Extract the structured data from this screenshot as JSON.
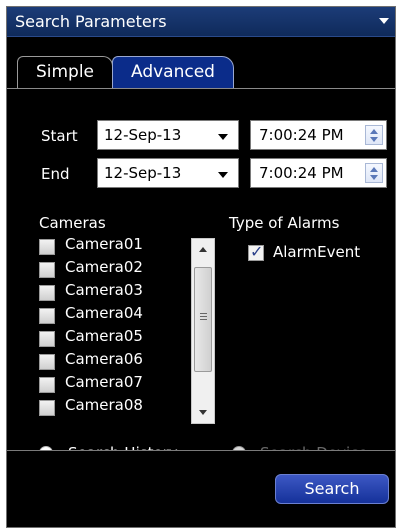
{
  "panel": {
    "title": "Search Parameters"
  },
  "tabs": {
    "simple": "Simple",
    "advanced": "Advanced"
  },
  "range": {
    "start_label": "Start",
    "end_label": "End",
    "start_date": "12-Sep-13",
    "end_date": "12-Sep-13",
    "start_time": "7:00:24 PM",
    "end_time": "7:00:24 PM"
  },
  "cameras": {
    "heading": "Cameras",
    "items": [
      "Camera01",
      "Camera02",
      "Camera03",
      "Camera04",
      "Camera05",
      "Camera06",
      "Camera07",
      "Camera08"
    ]
  },
  "alarms": {
    "heading": "Type of Alarms",
    "item": "AlarmEvent",
    "checked": true
  },
  "mode": {
    "history_label": "Search History",
    "device_label": "Search Device"
  },
  "actions": {
    "search_label": "Search"
  },
  "colors": {
    "accent": "#1a3a9a",
    "titlebar": "#14356e",
    "disabled_text": "#6a6a6a"
  },
  "icons": {
    "collapse": "chevron-down-icon",
    "spinner": "spin-updown-icon",
    "dropdown": "dropdown-arrow-icon"
  }
}
